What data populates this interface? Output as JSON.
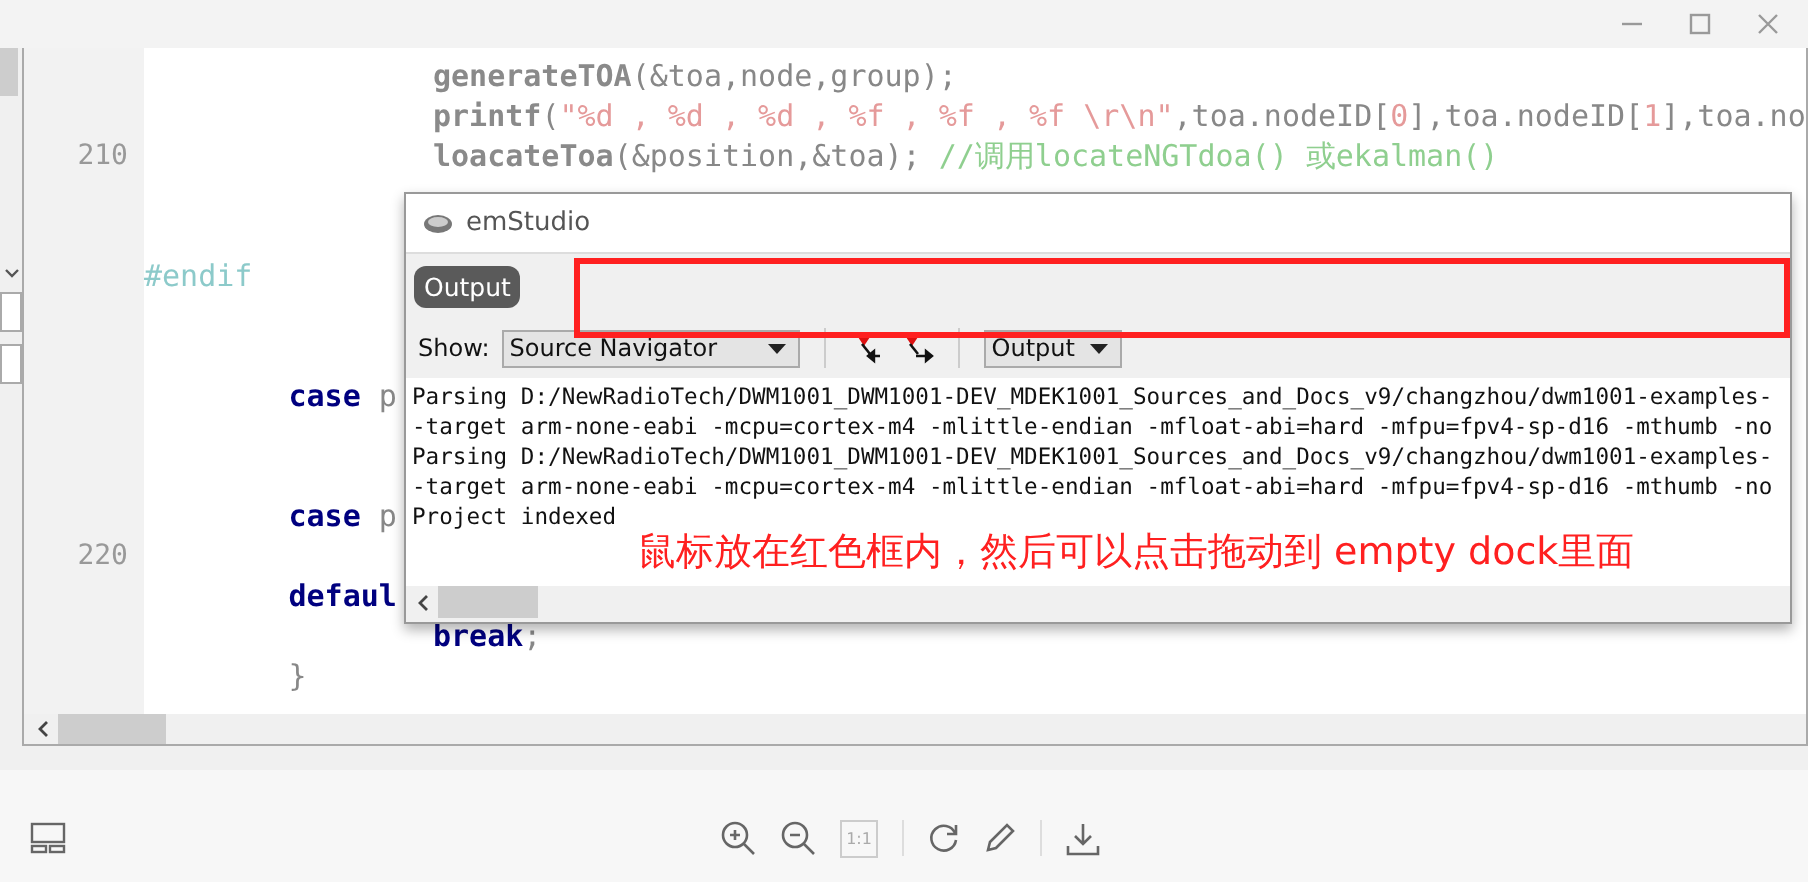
{
  "editor": {
    "lines": [
      {
        "kind": "code",
        "tokens": [
          {
            "kind": "function",
            "text": "                generateTOA"
          },
          {
            "kind": "plain",
            "text": "(&toa,node,group);"
          }
        ]
      },
      {
        "kind": "code",
        "tokens": [
          {
            "kind": "function",
            "text": "                printf"
          },
          {
            "kind": "plain",
            "text": "("
          },
          {
            "kind": "string",
            "text": "\"%d , %d , %d , %f , %f , %f \\r\\n\""
          },
          {
            "kind": "plain",
            "text": ",toa.nodeID["
          },
          {
            "kind": "number",
            "text": "0"
          },
          {
            "kind": "plain",
            "text": "],toa.nodeID["
          },
          {
            "kind": "number",
            "text": "1"
          },
          {
            "kind": "plain",
            "text": "],toa.no"
          }
        ]
      },
      {
        "kind": "code",
        "number": "210",
        "tokens": [
          {
            "kind": "function",
            "text": "                loacateToa"
          },
          {
            "kind": "plain",
            "text": "(&position,&toa); "
          },
          {
            "kind": "comment",
            "text": "//调用locateNGTdoa() 或ekalman()"
          }
        ]
      },
      {
        "kind": "blank"
      },
      {
        "kind": "blank"
      },
      {
        "kind": "code",
        "tokens": [
          {
            "kind": "directive",
            "text": "#endif"
          }
        ]
      },
      {
        "kind": "blank"
      },
      {
        "kind": "blank"
      },
      {
        "kind": "code",
        "tokens": [
          {
            "kind": "keyword",
            "text": "        case"
          },
          {
            "kind": "plain",
            "text": " p"
          }
        ]
      },
      {
        "kind": "blank"
      },
      {
        "kind": "blank"
      },
      {
        "kind": "code",
        "tokens": [
          {
            "kind": "keyword",
            "text": "        case"
          },
          {
            "kind": "plain",
            "text": " p"
          }
        ]
      },
      {
        "kind": "blank",
        "number": "220"
      },
      {
        "kind": "code",
        "tokens": [
          {
            "kind": "keyword",
            "text": "        defaul"
          }
        ]
      },
      {
        "kind": "code",
        "tokens": [
          {
            "kind": "keyword",
            "text": "                break"
          },
          {
            "kind": "plain",
            "text": ";"
          }
        ]
      },
      {
        "kind": "code",
        "tokens": [
          {
            "kind": "plain",
            "text": "        }"
          }
        ]
      }
    ]
  },
  "dialog": {
    "title": "emStudio",
    "output_button": "Output",
    "show_label": "Show:",
    "show_value": "Source Navigator",
    "output_value": "Output",
    "output_lines": [
      "Parsing D:/NewRadioTech/DWM1001_DWM1001-DEV_MDEK1001_Sources_and_Docs_v9/changzhou/dwm1001-examples-",
      "-target arm-none-eabi -mcpu=cortex-m4 -mlittle-endian -mfloat-abi=hard -mfpu=fpv4-sp-d16 -mthumb -no",
      "Parsing D:/NewRadioTech/DWM1001_DWM1001-DEV_MDEK1001_Sources_and_Docs_v9/changzhou/dwm1001-examples-",
      "-target arm-none-eabi -mcpu=cortex-m4 -mlittle-endian -mfloat-abi=hard -mfpu=fpv4-sp-d16 -mthumb -no",
      "Project indexed"
    ],
    "annotation": "鼠标放在红色框内，然后可以点击拖动到 empty dock里面"
  },
  "toolbar": {
    "actual_size": "1:1"
  }
}
